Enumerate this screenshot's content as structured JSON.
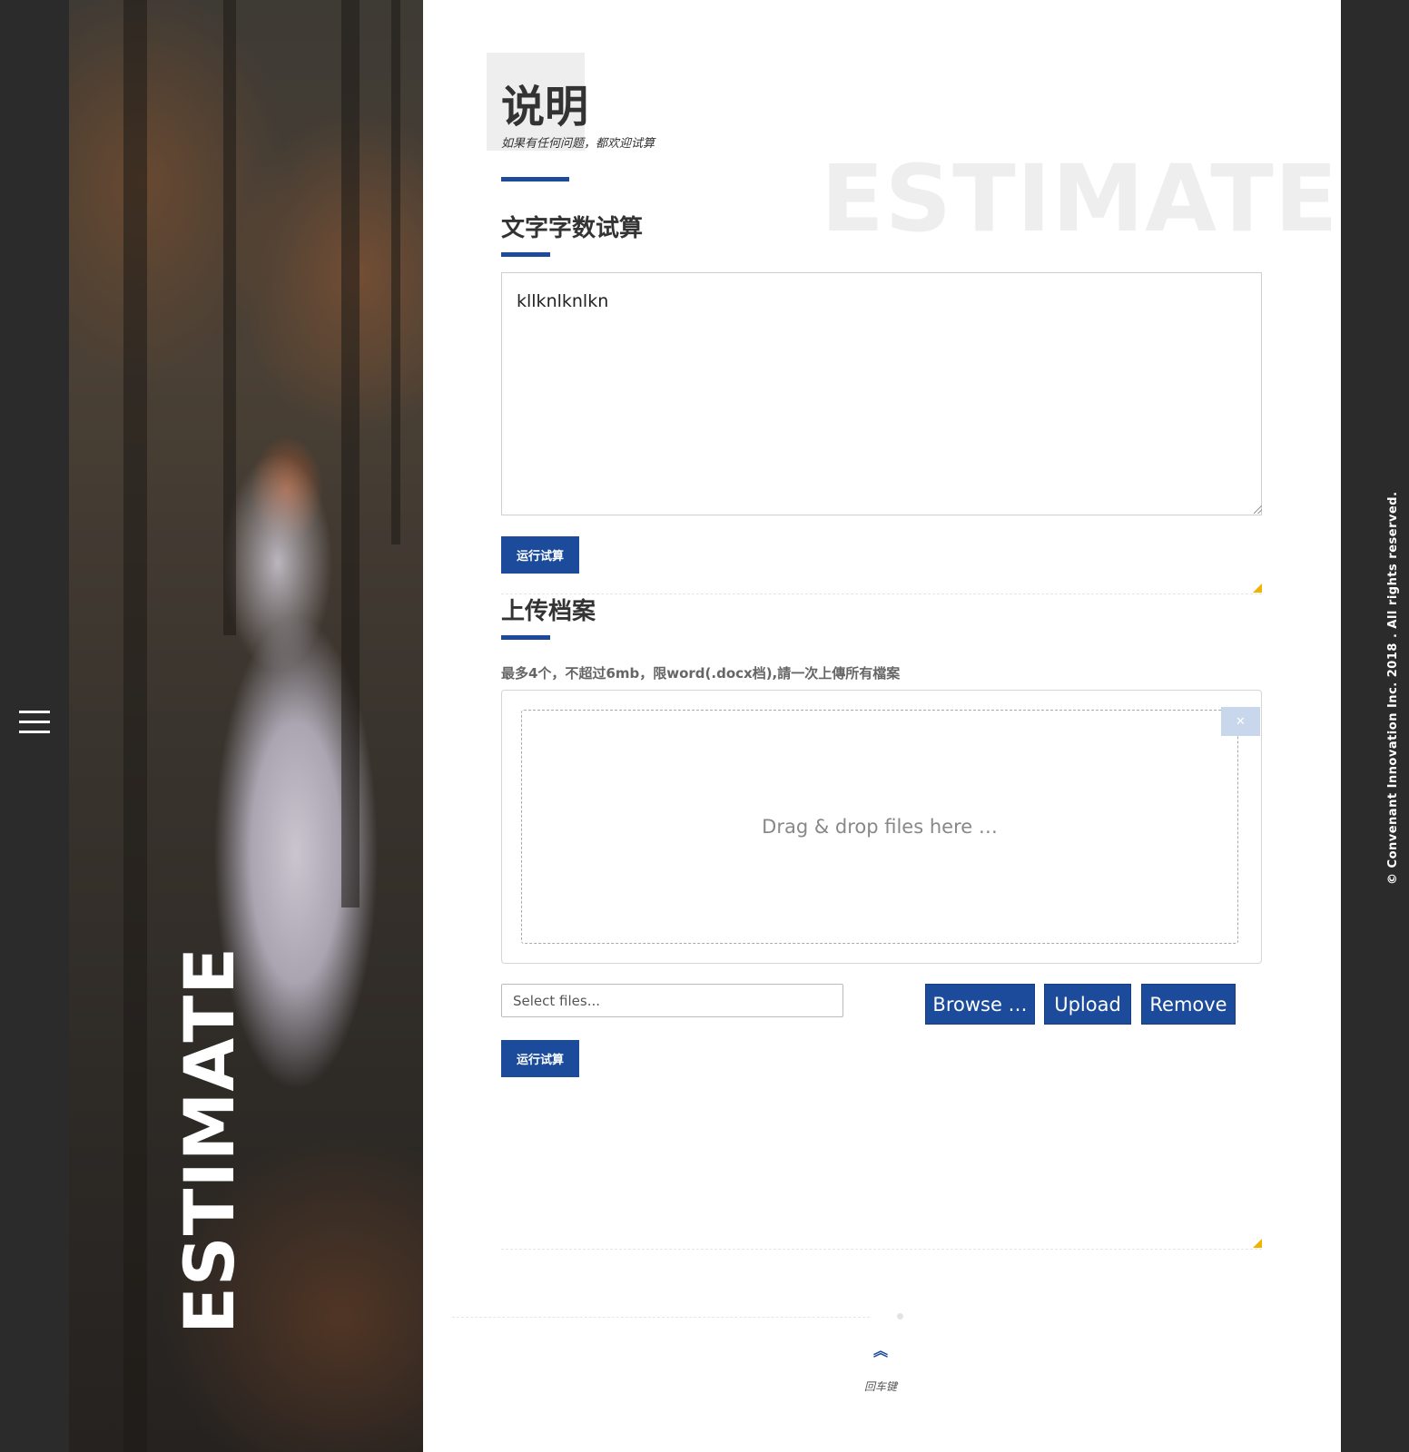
{
  "nav": {
    "menu_icon": "hamburger-menu-icon"
  },
  "hero": {
    "vertical_word": "ESTIMATE"
  },
  "header": {
    "title": "说明",
    "subtitle": "如果有任何问题，都欢迎试算",
    "watermark": "ESTIMATE"
  },
  "text_estimate": {
    "heading": "文字字数试算",
    "textarea_value": "kllknlknlkn",
    "run_button": "运行试算"
  },
  "upload": {
    "heading": "上传档案",
    "help": "最多4个，不超过6mb，限word(.docx档),請一次上傳所有檔案",
    "drop_text": "Drag & drop files here …",
    "close_icon": "close-icon",
    "file_placeholder": "Select files...",
    "browse_button": "Browse …",
    "upload_button": "Upload",
    "remove_button": "Remove",
    "run_button": "运行试算"
  },
  "footer": {
    "back_label": "回车键",
    "up_icon": "double-chevron-up-icon",
    "copyright": "© Convenant Innovation Inc. 2018 . All rights reserved."
  },
  "colors": {
    "accent": "#1b4b9a",
    "dark_rail": "#2b2b2b",
    "corner_mark": "#f0b400"
  }
}
